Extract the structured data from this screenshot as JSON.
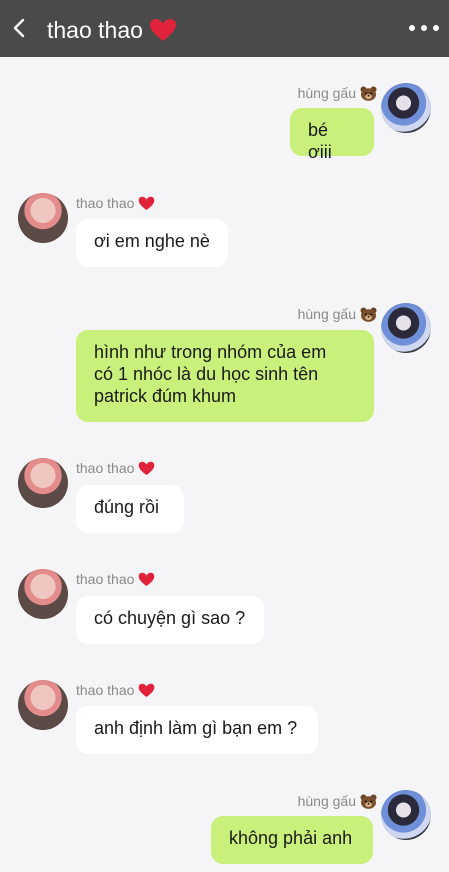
{
  "header": {
    "title": "thao thao",
    "back_icon": "chevron-left-icon",
    "heart_icon": "red-heart-icon",
    "more_icon": "more-horizontal-icon",
    "background": "#4a4a4a"
  },
  "colors": {
    "outgoing_bubble": "#c9f07a",
    "incoming_bubble": "#ffffff",
    "heart": "#e0223a"
  },
  "messages": [
    {
      "sender": "hùng gấu",
      "direction": "out",
      "text": "bé ơiii"
    },
    {
      "sender": "thao thao",
      "direction": "in",
      "text": "ơi em nghe nè"
    },
    {
      "sender": "hùng gấu",
      "direction": "out",
      "lines": [
        "hình như trong nhóm của em",
        "có 1 nhóc là du học sinh tên",
        "patrick đúm khum"
      ]
    },
    {
      "sender": "thao thao",
      "direction": "in",
      "text": "đúng rồi"
    },
    {
      "sender": "thao thao",
      "direction": "in",
      "text": "có chuyện gì sao ?"
    },
    {
      "sender": "thao thao",
      "direction": "in",
      "text": "anh định làm gì bạn em ?"
    },
    {
      "sender": "hùng gấu",
      "direction": "out",
      "text": "không phải anh"
    }
  ]
}
